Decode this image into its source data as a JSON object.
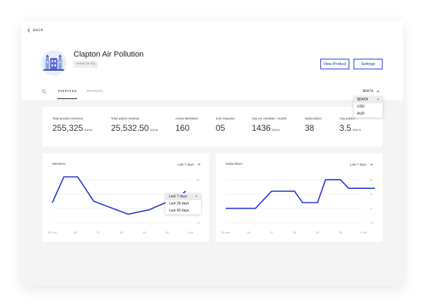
{
  "nav": {
    "back_label": "BACK"
  },
  "header": {
    "title": "Clapton Air Pollution",
    "address": "0x38X…6c7Fg",
    "view_product_label": "View Product",
    "settings_label": "Settings"
  },
  "tabs": [
    {
      "label": "OVERVIEW",
      "active": true
    },
    {
      "label": "MEMBERS",
      "active": false
    }
  ],
  "currency": {
    "selected": "$DATA",
    "options": [
      {
        "label": "$DATA",
        "selected": true
      },
      {
        "label": "USD",
        "selected": false
      },
      {
        "label": "AUD",
        "selected": false
      }
    ]
  },
  "stats": [
    {
      "label": "Total product revenue",
      "value": "255,325",
      "unit": "DATA"
    },
    {
      "label": "Total admin revenue",
      "value": "25,532.50",
      "unit": "DATA"
    },
    {
      "label": "Active Members",
      "value": "160",
      "unit": ""
    },
    {
      "label": "Join requests",
      "value": "05",
      "unit": ""
    },
    {
      "label": "Avg rev member / month",
      "value": "1436",
      "unit": "DATA"
    },
    {
      "label": "Subscribers",
      "value": "38",
      "unit": ""
    },
    {
      "label": "Avg subscr…",
      "value": "3.5",
      "unit": "DAYS"
    }
  ],
  "members_card": {
    "title": "Members",
    "range_label": "Last 7 days",
    "range_options": [
      {
        "label": "Last 7 days",
        "selected": true
      },
      {
        "label": "Last 28 days",
        "selected": false
      },
      {
        "label": "Last 90 days",
        "selected": false
      }
    ]
  },
  "subscribers_card": {
    "title": "Subscribers",
    "range_label": "Last 7 days"
  },
  "colors": {
    "accent": "#1c2fd6",
    "button_border": "#2b3de0"
  },
  "chart_data": [
    {
      "type": "line",
      "title": "Members",
      "x": [
        "25 Jun",
        "26",
        "27",
        "28",
        "29",
        "30",
        "1 Jul"
      ],
      "yticks": [
        -5,
        0,
        5,
        10
      ],
      "ylim": [
        -6,
        11
      ],
      "grid": true,
      "series": [
        {
          "points": [
            [
              0,
              2
            ],
            [
              0.5,
              11
            ],
            [
              1.1,
              11
            ],
            [
              1.8,
              2.5
            ],
            [
              3.3,
              -2
            ],
            [
              4.2,
              -0.5
            ],
            [
              5.5,
              4
            ],
            [
              5.8,
              6
            ]
          ]
        }
      ]
    },
    {
      "type": "line",
      "title": "Subscribers",
      "x": [
        "25 Jun",
        "26",
        "27",
        "28",
        "29",
        "30",
        "1 Jul"
      ],
      "yticks": [
        -5,
        0,
        5,
        10
      ],
      "ylim": [
        -6,
        11
      ],
      "grid": true,
      "series": [
        {
          "points": [
            [
              0,
              0
            ],
            [
              1.3,
              0
            ],
            [
              2.0,
              6
            ],
            [
              3.0,
              6
            ],
            [
              3.35,
              2
            ],
            [
              4.0,
              2
            ],
            [
              4.35,
              10
            ],
            [
              5.0,
              10
            ],
            [
              5.35,
              7
            ],
            [
              6.5,
              7
            ]
          ]
        }
      ]
    }
  ]
}
